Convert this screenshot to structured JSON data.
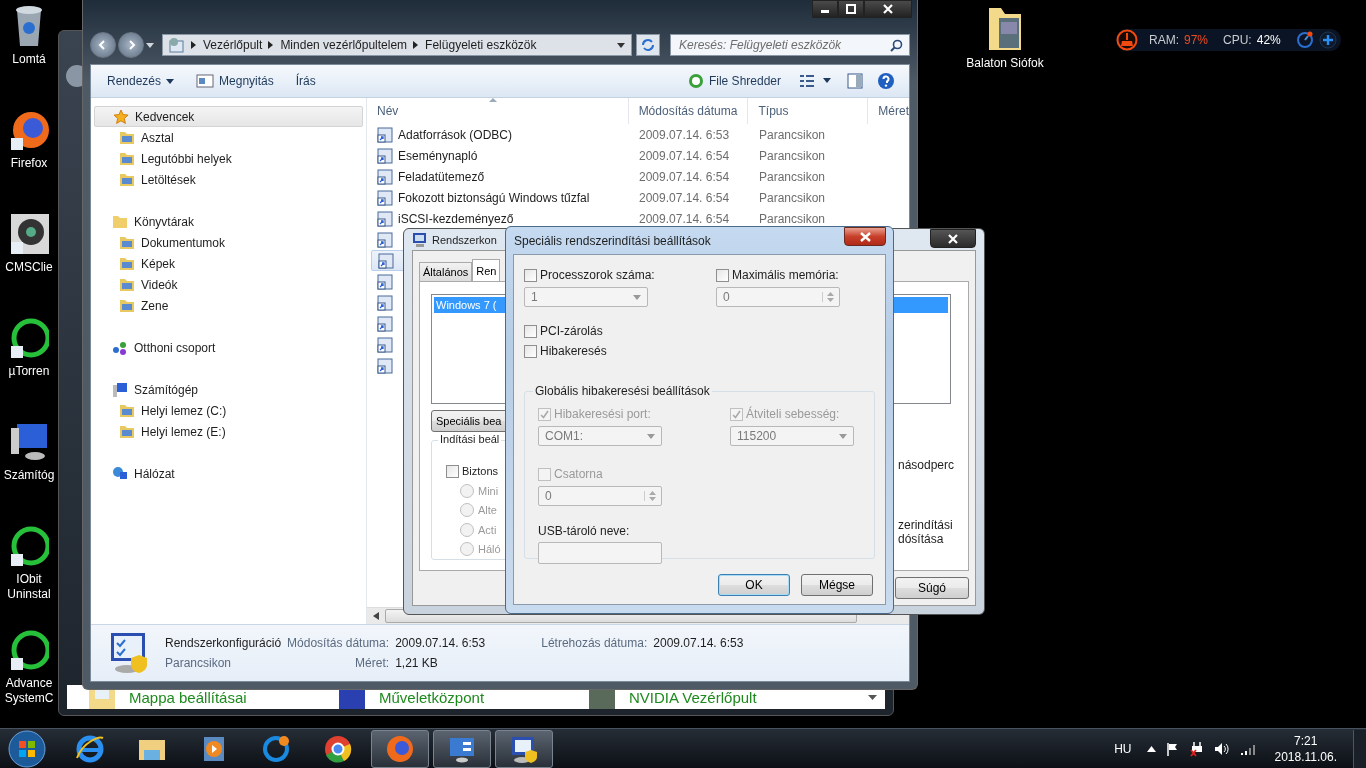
{
  "desktop_icons": [
    {
      "label": "Lomtá"
    },
    {
      "label": "Firefox"
    },
    {
      "label": "CMSClie"
    },
    {
      "label": "µTorren"
    },
    {
      "label": "Számítóg"
    },
    {
      "label": "IObit Uninstal"
    },
    {
      "label": "Advance SystemC"
    }
  ],
  "desktop_folder": {
    "label": "Balaton Siófok"
  },
  "system_monitor": {
    "ram_label": "RAM:",
    "ram_value": "97%",
    "cpu_label": "CPU:",
    "cpu_value": "42%"
  },
  "background_window": {
    "items": [
      "Mappa beállításai",
      "Műveletközpont",
      "NVIDIA Vezérlőpult"
    ]
  },
  "explorer": {
    "breadcrumb": [
      "Vezérlőpult",
      "Minden vezérlőpultelem",
      "Felügyeleti eszközök"
    ],
    "search": {
      "placeholder": "Keresés: Felügyeleti eszközök"
    },
    "toolbar": [
      {
        "label": "Rendezés",
        "kind": "menu"
      },
      {
        "label": "Megnyitás",
        "kind": "open"
      },
      {
        "label": "Írás",
        "kind": "plain"
      }
    ],
    "shredder": "File Shredder",
    "nav": [
      {
        "label": "Kedvencek",
        "selected": true,
        "children": [
          {
            "label": "Asztal",
            "selected": false
          },
          {
            "label": "Legutóbbi helyek",
            "selected": false
          },
          {
            "label": "Letöltések",
            "selected": false
          }
        ]
      },
      {
        "label": "Könyvtárak",
        "selected": false,
        "children": [
          {
            "label": "Dokumentumok",
            "selected": false
          },
          {
            "label": "Képek",
            "selected": false
          },
          {
            "label": "Videók",
            "selected": false
          },
          {
            "label": "Zene",
            "selected": false
          }
        ]
      },
      {
        "label": "Otthoni csoport",
        "selected": false
      },
      {
        "label": "Számítógép",
        "selected": false,
        "children": [
          {
            "label": "Helyi lemez (C:)",
            "selected": false
          },
          {
            "label": "Helyi lemez (E:)",
            "selected": false
          }
        ]
      },
      {
        "label": "Hálózat",
        "selected": false
      }
    ],
    "columns": [
      "Név",
      "Módosítás dátuma",
      "Típus",
      "Méret"
    ],
    "rows": [
      {
        "name": "Adatforrások (ODBC)",
        "date": "2009.07.14. 6:53",
        "type": "Parancsikon",
        "selected": false
      },
      {
        "name": "Eseménynapló",
        "date": "2009.07.14. 6:54",
        "type": "Parancsikon",
        "selected": false
      },
      {
        "name": "Feladatütemező",
        "date": "2009.07.14. 6:54",
        "type": "Parancsikon",
        "selected": false
      },
      {
        "name": "Fokozott biztonságú Windows tűzfal",
        "date": "2009.07.14. 6:54",
        "type": "Parancsikon",
        "selected": false
      },
      {
        "name": "iSCSI-kezdeményező",
        "date": "2009.07.14. 6:54",
        "type": "Parancsikon",
        "selected": false
      }
    ],
    "covered_rows": [
      {
        "selected": false
      },
      {
        "selected": true
      },
      {
        "selected": false
      },
      {
        "selected": false
      },
      {
        "selected": false
      },
      {
        "selected": false
      },
      {
        "selected": false
      }
    ],
    "details": {
      "name": "Rendszerkonfiguráció",
      "type": "Parancsikon",
      "modified_label": "Módosítás dátuma:",
      "modified": "2009.07.14. 6:53",
      "size_label": "Méret:",
      "size": "1,21 KB",
      "created_label": "Létrehozás dátuma:",
      "created": "2009.07.14. 6:53"
    }
  },
  "sysconfig_dialog": {
    "title": "Rendszerkon",
    "tabs": [
      {
        "label": "Általános",
        "selected": false
      },
      {
        "label": "Ren",
        "selected": true
      }
    ],
    "boot_entries": [
      {
        "label": "Windows 7 (",
        "selected": true
      }
    ],
    "advanced_button": "Speciális bea",
    "boot_group": "Indítási beál",
    "safe_boot": {
      "label": "Biztons",
      "checked": false
    },
    "safe_boot_modes": [
      {
        "label": "Mini",
        "selected": false
      },
      {
        "label": "Alte",
        "selected": false
      },
      {
        "label": "Acti",
        "selected": false
      },
      {
        "label": "Háló",
        "selected": false
      }
    ],
    "right_texts": [
      "násodperc",
      "zerindítási",
      "dósítása"
    ],
    "help_button": "Súgó"
  },
  "advanced_dialog": {
    "title": "Speciális rendszerindítási beállítások",
    "processors": {
      "label": "Processzorok száma:",
      "checked": false,
      "value": "1"
    },
    "max_memory": {
      "label": "Maximális memória:",
      "checked": false,
      "value": "0"
    },
    "options": [
      {
        "label": "PCI-zárolás",
        "checked": false
      },
      {
        "label": "Hibakeresés",
        "checked": false
      }
    ],
    "debug_group": {
      "title": "Globális hibakeresési beállítások",
      "port": {
        "label": "Hibakeresési port:",
        "checked": true,
        "disabled": true,
        "value": "COM1:"
      },
      "baud": {
        "label": "Átviteli sebesség:",
        "checked": true,
        "disabled": true,
        "value": "115200"
      },
      "channel": {
        "label": "Csatorna",
        "checked": false,
        "disabled": true,
        "value": "0"
      },
      "usb_label": "USB-tároló neve:"
    },
    "buttons": [
      "OK",
      "Mégse"
    ]
  },
  "taskbar": {
    "apps": [
      {
        "active": false
      },
      {
        "active": false
      },
      {
        "active": false
      },
      {
        "active": false
      },
      {
        "active": false
      },
      {
        "active": true
      },
      {
        "active": true
      },
      {
        "active": true
      }
    ],
    "language": "HU",
    "time": "7:21",
    "date": "2018.11.06."
  }
}
